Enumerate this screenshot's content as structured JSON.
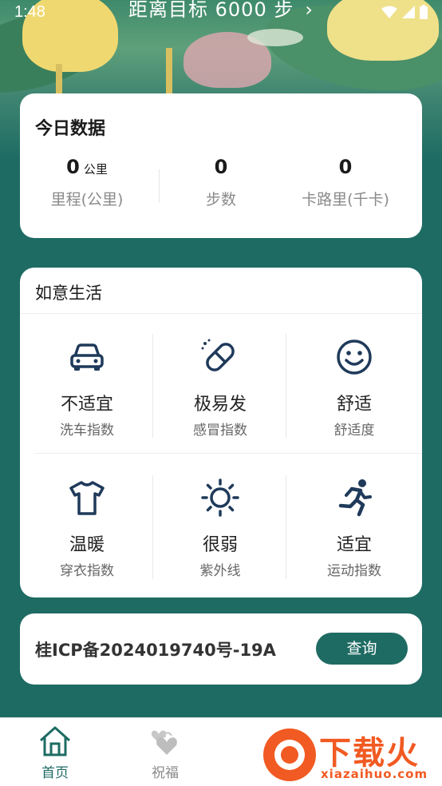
{
  "status_bar": {
    "time": "1:48"
  },
  "header": {
    "goal_text": "距离目标 6000 步",
    "goal_chevron": "›"
  },
  "today": {
    "title": "今日数据",
    "stats": [
      {
        "value": "0",
        "unit": "公里",
        "label": "里程(公里)"
      },
      {
        "value": "0",
        "unit": "",
        "label": "步数"
      },
      {
        "value": "0",
        "unit": "",
        "label": "卡路里(千卡)"
      }
    ]
  },
  "life": {
    "title": "如意生活",
    "tiles": [
      {
        "icon": "car-icon",
        "value": "不适宜",
        "label": "洗车指数"
      },
      {
        "icon": "pill-icon",
        "value": "极易发",
        "label": "感冒指数"
      },
      {
        "icon": "smile-icon",
        "value": "舒适",
        "label": "舒适度"
      },
      {
        "icon": "shirt-icon",
        "value": "温暖",
        "label": "穿衣指数"
      },
      {
        "icon": "sun-icon",
        "value": "很弱",
        "label": "紫外线"
      },
      {
        "icon": "running-icon",
        "value": "适宜",
        "label": "运动指数"
      }
    ]
  },
  "icp": {
    "text": "桂ICP备2024019740号-19A",
    "button": "查询"
  },
  "nav": {
    "items": [
      {
        "icon": "home-icon",
        "label": "首页",
        "active": true
      },
      {
        "icon": "hearts-icon",
        "label": "祝福",
        "active": false
      }
    ]
  },
  "watermark": {
    "title": "下载火",
    "url": "xiazaihuo.com"
  },
  "colors": {
    "primary": "#1e6b63",
    "icon": "#1f3a5a",
    "watermark": "#f15a22"
  }
}
